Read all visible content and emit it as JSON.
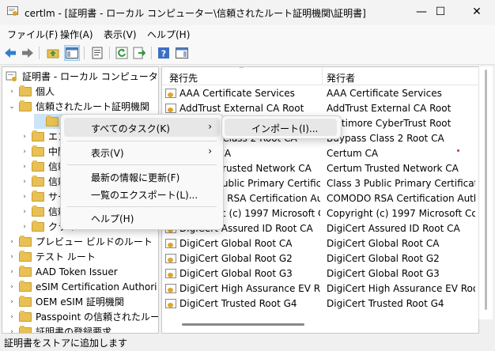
{
  "window": {
    "title": "certlm - [証明書 - ローカル コンピューター\\信頼されたルート証明機関\\証明書]",
    "minimize": "—",
    "maximize": "☐",
    "close": "✕"
  },
  "menubar": {
    "items": [
      "ファイル(F)",
      "操作(A)",
      "表示(V)",
      "ヘルプ(H)"
    ]
  },
  "toolbar": {
    "icons": [
      "back-arrow-icon",
      "forward-arrow-icon",
      "up-folder-icon",
      "show-hide-tree-icon",
      "properties-icon",
      "refresh-icon",
      "export-list-icon",
      "help-icon",
      "show-action-pane-icon"
    ]
  },
  "tree": {
    "root": "証明書 - ローカル コンピューター",
    "items": [
      {
        "label": "個人",
        "expander": "›"
      },
      {
        "label": "信頼されたルート証明機関",
        "expander": "⌄"
      },
      {
        "label": "証明書",
        "expander": ""
      },
      {
        "label": "エンタ",
        "expander": "›"
      },
      {
        "label": "中間証",
        "expander": "›"
      },
      {
        "label": "信頼さ",
        "expander": "›"
      },
      {
        "label": "信頼さ",
        "expander": "›"
      },
      {
        "label": "サード",
        "expander": "›"
      },
      {
        "label": "信頼さ",
        "expander": "›"
      },
      {
        "label": "クライ",
        "expander": "›"
      },
      {
        "label": "プレビュー ビルドのルート",
        "expander": "›"
      },
      {
        "label": "テスト ルート",
        "expander": "›"
      },
      {
        "label": "AAD Token Issuer",
        "expander": "›"
      },
      {
        "label": "eSIM Certification Authori",
        "expander": "›"
      },
      {
        "label": "OEM eSIM 証明機関",
        "expander": "›"
      },
      {
        "label": "Passpoint の信頼されたルー",
        "expander": "›"
      },
      {
        "label": "証明書の登録要求",
        "expander": "›"
      }
    ]
  },
  "list": {
    "col1": "発行先",
    "col2": "発行者",
    "rows": [
      {
        "to": "AAA Certificate Services",
        "by": "AAA Certificate Services"
      },
      {
        "to": "AddTrust External CA Root",
        "by": "AddTrust External CA Root"
      },
      {
        "to": "Baltimore CyberTrust Root",
        "by": "Baltimore CyberTrust Root"
      },
      {
        "to": "Buypass Class 2 Root CA",
        "by": "Buypass Class 2 Root CA"
      },
      {
        "to": "Certum CA",
        "by": "Certum CA"
      },
      {
        "to": "Certum Trusted Network CA",
        "by": "Certum Trusted Network CA"
      },
      {
        "to": "Class 3 Public Primary Certification...",
        "by": "Class 3 Public Primary Certificatio..."
      },
      {
        "to": "COMODO RSA Certification Autho...",
        "by": "COMODO RSA Certification Autho..."
      },
      {
        "to": "Copyright (c) 1997 Microsoft Corp.",
        "by": "Copyright (c) 1997 Microsoft Corp."
      },
      {
        "to": "DigiCert Assured ID Root CA",
        "by": "DigiCert Assured ID Root CA"
      },
      {
        "to": "DigiCert Global Root CA",
        "by": "DigiCert Global Root CA"
      },
      {
        "to": "DigiCert Global Root G2",
        "by": "DigiCert Global Root G2"
      },
      {
        "to": "DigiCert Global Root G3",
        "by": "DigiCert Global Root G3"
      },
      {
        "to": "DigiCert High Assurance EV Root ...",
        "by": "DigiCert High Assurance EV Root ..."
      },
      {
        "to": "DigiCert Trusted Root G4",
        "by": "DigiCert Trusted Root G4"
      }
    ]
  },
  "context_menu": {
    "items": [
      {
        "label": "すべてのタスク(K)",
        "arrow": "›"
      },
      {
        "label": "表示(V)",
        "arrow": "›"
      },
      {
        "label": "最新の情報に更新(F)",
        "arrow": ""
      },
      {
        "label": "一覧のエクスポート(L)...",
        "arrow": ""
      },
      {
        "label": "ヘルプ(H)",
        "arrow": ""
      }
    ]
  },
  "submenu": {
    "items": [
      {
        "label": "インポート(I)..."
      }
    ]
  },
  "status": {
    "text": "証明書をストアに追加します"
  }
}
